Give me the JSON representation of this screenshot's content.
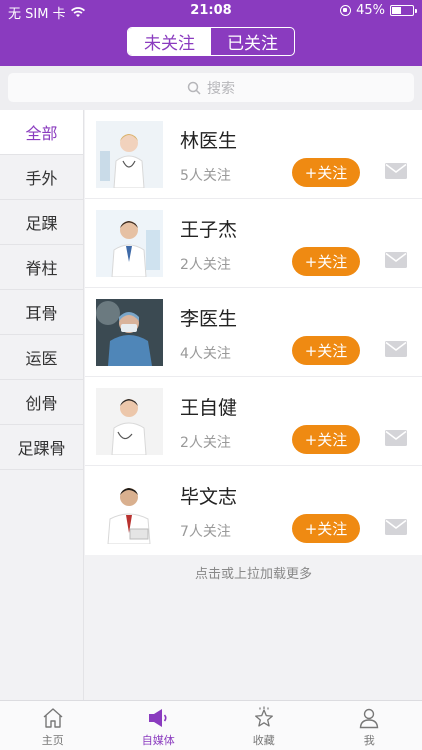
{
  "status_bar": {
    "carrier": "无 SIM 卡",
    "time": "21:08",
    "battery": "45%",
    "battery_level": 0.45
  },
  "segment": {
    "tabs": [
      "未关注",
      "已关注"
    ],
    "active_index": 0
  },
  "search": {
    "placeholder": "搜索"
  },
  "sidebar": {
    "items": [
      "全部",
      "手外",
      "足踝",
      "脊柱",
      "耳骨",
      "运医",
      "创骨",
      "足踝骨"
    ],
    "active_index": 0
  },
  "doctors": [
    {
      "name": "林医生",
      "followers": "5人关注",
      "follow_label": "+关注"
    },
    {
      "name": "王子杰",
      "followers": "2人关注",
      "follow_label": "+关注"
    },
    {
      "name": "李医生",
      "followers": "4人关注",
      "follow_label": "+关注"
    },
    {
      "name": "王自健",
      "followers": "2人关注",
      "follow_label": "+关注"
    },
    {
      "name": "毕文志",
      "followers": "7人关注",
      "follow_label": "+关注"
    }
  ],
  "load_more": "点击或上拉加载更多",
  "tabbar": {
    "items": [
      {
        "label": "主页",
        "icon": "home-icon"
      },
      {
        "label": "自媒体",
        "icon": "megaphone-icon"
      },
      {
        "label": "收藏",
        "icon": "star-icon"
      },
      {
        "label": "我",
        "icon": "user-icon"
      }
    ],
    "active_index": 1
  },
  "colors": {
    "brand": "#8a3bbf",
    "follow_button": "#ef8a12"
  }
}
